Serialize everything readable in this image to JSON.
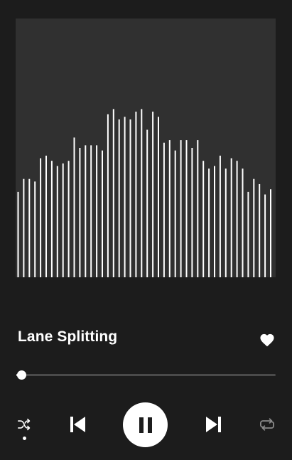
{
  "track": {
    "title": "Lane Splitting",
    "liked": true,
    "progress": 0.02
  },
  "artwork": {
    "background": "#303030",
    "bar_color": "#ffffff",
    "bars": [
      0.33,
      0.38,
      0.38,
      0.37,
      0.46,
      0.47,
      0.45,
      0.43,
      0.44,
      0.45,
      0.54,
      0.5,
      0.51,
      0.51,
      0.51,
      0.49,
      0.63,
      0.65,
      0.61,
      0.62,
      0.61,
      0.64,
      0.65,
      0.57,
      0.64,
      0.62,
      0.52,
      0.53,
      0.49,
      0.53,
      0.53,
      0.5,
      0.53,
      0.45,
      0.42,
      0.43,
      0.47,
      0.42,
      0.46,
      0.45,
      0.42,
      0.33,
      0.38,
      0.36,
      0.32,
      0.34
    ]
  },
  "controls": {
    "shuffle_icon": "shuffle-icon",
    "shuffle_active": true,
    "previous_icon": "skip-previous-icon",
    "play_state_icon": "pause-icon",
    "next_icon": "skip-next-icon",
    "repeat_icon": "repeat-icon"
  },
  "colors": {
    "background": "#1c1c1c",
    "accent": "#ffffff",
    "track": "#4a4a4a"
  }
}
